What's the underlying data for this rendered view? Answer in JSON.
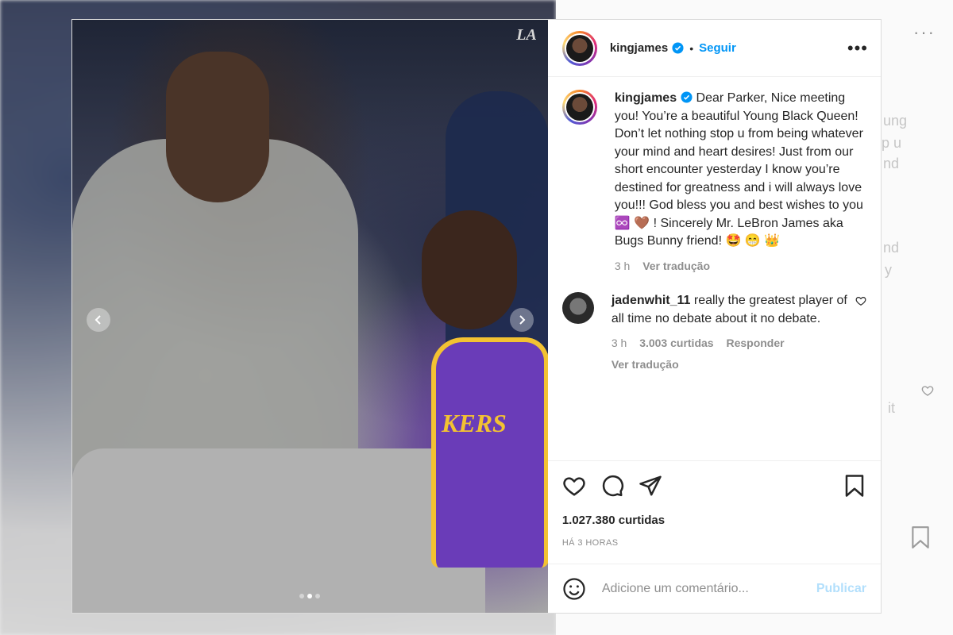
{
  "background": {
    "ghost_lines": [
      "ung",
      "p u",
      "nd",
      "nd",
      "y",
      "it"
    ],
    "more_glyph": "···"
  },
  "media": {
    "team_logo": "LA",
    "jersey_text": "KERS",
    "carousel": {
      "count": 3,
      "active_index": 1
    }
  },
  "post": {
    "header": {
      "username": "kingjames",
      "separator": "•",
      "follow_label": "Seguir",
      "more_glyph": "•••"
    },
    "caption": {
      "username": "kingjames",
      "text": "Dear Parker, Nice meeting you! You’re a beautiful Young Black Queen! Don’t let nothing stop u from being whatever your mind and heart desires! Just from our short encounter yesterday I know you’re destined for greatness and i will always love you!!! God bless you and best wishes to you ♾️ 🤎 ! Sincerely Mr. LeBron James aka Bugs Bunny friend! 🤩 😁 👑",
      "time": "3 h",
      "translate": "Ver tradução"
    },
    "comments": [
      {
        "username": "jadenwhit_11",
        "text": "really the greatest player of all time no debate about it no debate.",
        "time": "3 h",
        "likes": "3.003 curtidas",
        "reply": "Responder",
        "translate": "Ver tradução"
      }
    ],
    "likes_count": "1.027.380 curtidas",
    "timestamp": "HÁ 3 HORAS",
    "add_comment": {
      "placeholder": "Adicione um comentário...",
      "publish": "Publicar"
    }
  },
  "colors": {
    "accent_blue": "#0095f6",
    "publish_disabled": "#b2dffc",
    "muted_text": "#8e8e8e"
  }
}
